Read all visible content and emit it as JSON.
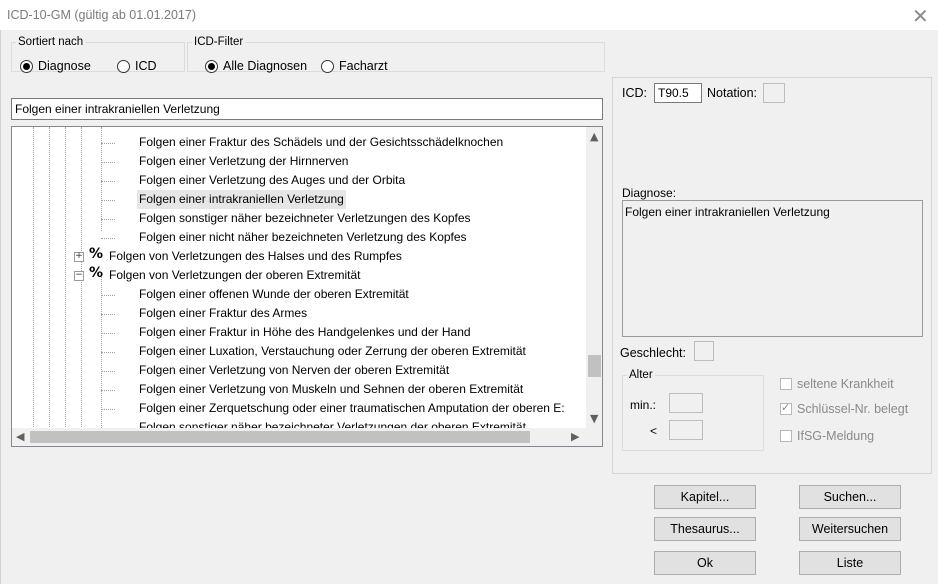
{
  "window": {
    "title": "ICD-10-GM (gültig ab 01.01.2017)",
    "close": "✕"
  },
  "sort": {
    "legend": "Sortiert nach",
    "opt1": "Diagnose",
    "opt2": "ICD"
  },
  "filter": {
    "legend": "ICD-Filter",
    "opt1": "Alle Diagnosen",
    "opt2": "Facharzt"
  },
  "search_value": "Folgen einer intrakraniellen Verletzung",
  "tree": {
    "items": [
      "Folgen einer Fraktur des Schädels und der Gesichtsschädelknochen",
      "Folgen einer Verletzung der Hirnnerven",
      "Folgen einer Verletzung des Auges und der Orbita",
      "Folgen einer intrakraniellen Verletzung",
      "Folgen sonstiger näher bezeichneter Verletzungen des Kopfes",
      "Folgen einer nicht näher bezeichneten Verletzung des Kopfes",
      "Folgen von Verletzungen des Halses und des Rumpfes",
      "Folgen von Verletzungen der oberen Extremität",
      "Folgen einer offenen Wunde der oberen Extremität",
      "Folgen einer Fraktur des Armes",
      "Folgen einer Fraktur in Höhe des Handgelenkes und der Hand",
      "Folgen einer Luxation, Verstauchung oder Zerrung der oberen Extremität",
      "Folgen einer Verletzung von Nerven der oberen Extremität",
      "Folgen einer Verletzung von Muskeln und Sehnen der oberen Extremität",
      "Folgen einer Zerquetschung oder einer traumatischen Amputation der oberen E:",
      "Folgen sonstiger näher bezeichneter Verletzungen der oberen Extremität"
    ],
    "pct": "%",
    "plus": "+",
    "minus": "−"
  },
  "detail": {
    "icd_label": "ICD:",
    "icd_value": "T90.5",
    "notation_label": "Notation:",
    "diagnose_label": "Diagnose:",
    "diagnose_value": "Folgen einer intrakraniellen Verletzung",
    "geschlecht_label": "Geschlecht:",
    "alter_legend": "Alter",
    "min_label": "min.:",
    "lt_label": "<",
    "chk1": "seltene Krankheit",
    "chk2": "Schlüssel-Nr. belegt",
    "chk3": "IfSG-Meldung"
  },
  "buttons": {
    "kapitel": "Kapitel...",
    "suchen": "Suchen...",
    "thesaurus": "Thesaurus...",
    "weitersuchen": "Weitersuchen",
    "ok": "Ok",
    "liste": "Liste"
  },
  "scroll": {
    "up": "▲",
    "down": "▼",
    "left": "◀",
    "right": "▶"
  }
}
